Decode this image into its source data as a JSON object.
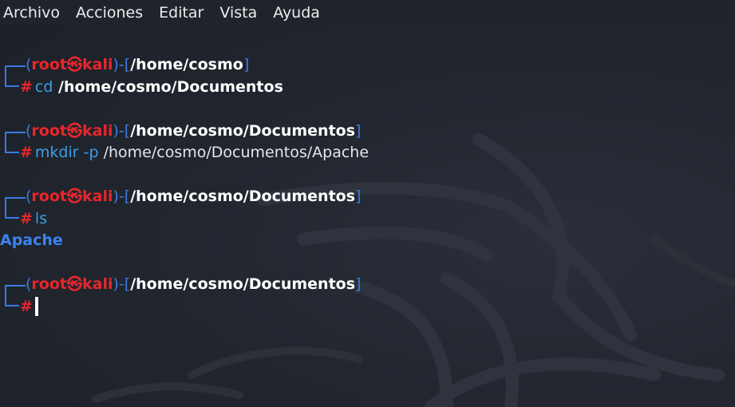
{
  "menubar": {
    "items": [
      "Archivo",
      "Acciones",
      "Editar",
      "Vista",
      "Ayuda"
    ]
  },
  "prompt": {
    "open": "(",
    "user": "root",
    "at_symbol": "㉿",
    "host": "kali",
    "close": ")",
    "dash": "-",
    "bracket_open": "[",
    "bracket_close": "]",
    "hash": "#"
  },
  "blocks": [
    {
      "path": "/home/cosmo",
      "command": "cd",
      "option": "",
      "argument": " /home/cosmo/Documentos",
      "output": ""
    },
    {
      "path": "/home/cosmo/Documentos",
      "command": "mkdir",
      "option": " -p",
      "argument": " /home/cosmo/Documentos/Apache",
      "output": ""
    },
    {
      "path": "/home/cosmo/Documentos",
      "command": "ls",
      "option": "",
      "argument": "",
      "output": "Apache"
    },
    {
      "path": "/home/cosmo/Documentos",
      "command": "",
      "option": "",
      "argument": "",
      "output": ""
    }
  ],
  "colors": {
    "background": "#20242d",
    "prompt_blue": "#3b7be0",
    "prompt_red": "#e8262b",
    "command_blue": "#3aa0e8",
    "directory_blue": "#3b82f0"
  }
}
